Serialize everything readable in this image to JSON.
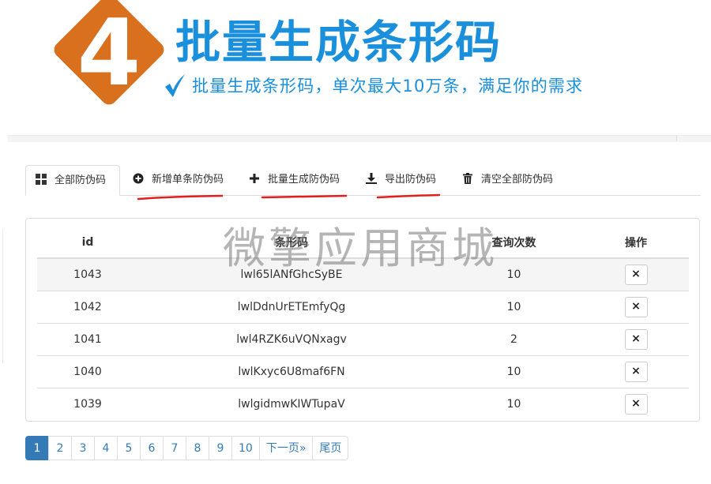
{
  "banner": {
    "number": "4",
    "title": "批量生成条形码",
    "subtitle": "批量生成条形码，单次最大10万条，满足你的需求",
    "accent_color": "#1a8fdc",
    "badge_color": "#d8701e"
  },
  "tabs": [
    {
      "label": "全部防伪码",
      "icon": "grid-icon",
      "active": true
    },
    {
      "label": "新增单条防伪码",
      "icon": "plus-circle-icon",
      "active": false
    },
    {
      "label": "批量生成防伪码",
      "icon": "plus-icon",
      "active": false
    },
    {
      "label": "导出防伪码",
      "icon": "download-icon",
      "active": false
    },
    {
      "label": "清空全部防伪码",
      "icon": "trash-icon",
      "active": false
    }
  ],
  "table": {
    "headers": [
      "id",
      "条形码",
      "查询次数",
      "操作"
    ],
    "rows": [
      {
        "id": "1043",
        "code": "lwl65lANfGhcSyBE",
        "count": "10",
        "action": "×"
      },
      {
        "id": "1042",
        "code": "lwlDdnUrETEmfyQg",
        "count": "10",
        "action": "×"
      },
      {
        "id": "1041",
        "code": "lwl4RZK6uVQNxagv",
        "count": "2",
        "action": "×"
      },
      {
        "id": "1040",
        "code": "lwlKxyc6U8maf6FN",
        "count": "10",
        "action": "×"
      },
      {
        "id": "1039",
        "code": "lwlgidmwKIWTupaV",
        "count": "10",
        "action": "×"
      }
    ]
  },
  "watermark": "微擎应用商城",
  "pagination": {
    "pages": [
      "1",
      "2",
      "3",
      "4",
      "5",
      "6",
      "7",
      "8",
      "9",
      "10"
    ],
    "current": "1",
    "next_label": "下一页»",
    "last_label": "尾页"
  },
  "colors": {
    "link": "#337ab7",
    "annotation_underline": "#e0201d"
  }
}
